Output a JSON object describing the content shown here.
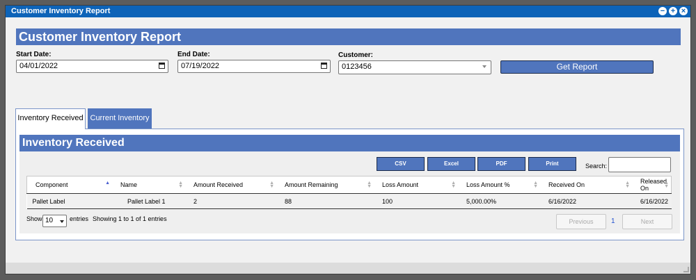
{
  "window": {
    "title": "Customer Inventory Report"
  },
  "report": {
    "title": "Customer Inventory Report",
    "start_date_label": "Start Date:",
    "start_date_value": "04/01/2022",
    "end_date_label": "End Date:",
    "end_date_value": "07/19/2022",
    "customer_label": "Customer:",
    "customer_value": "0123456",
    "get_report_label": "Get Report"
  },
  "tabs": [
    {
      "label": "Inventory Received",
      "active": true
    },
    {
      "label": "Current Inventory",
      "active": false
    }
  ],
  "section": {
    "title": "Inventory Received",
    "buttons": [
      "CSV",
      "Excel",
      "PDF",
      "Print"
    ],
    "search_label": "Search:",
    "columns": [
      "Component",
      "Name",
      "Amount Received",
      "Amount Remaining",
      "Loss Amount",
      "Loss Amount %",
      "Received On",
      "Released On"
    ],
    "rows": [
      [
        "Pallet Label",
        "Pallet Label 1",
        "2",
        "88",
        "100",
        "5,000.00%",
        "6/16/2022",
        "6/16/2022"
      ]
    ],
    "show_label": "Show",
    "entries_value": "10",
    "entries_label": "entries",
    "info": "Showing 1 to 1 of 1 entries",
    "previous_label": "Previous",
    "page": "1",
    "next_label": "Next"
  },
  "colors": {
    "accent": "#5075bd",
    "titlebar": "#0d63b8"
  },
  "icons": [
    "minimize-icon",
    "maximize-icon",
    "close-icon",
    "calendar-icon",
    "chevron-down-icon",
    "sort-icon",
    "resize-grip-icon"
  ]
}
